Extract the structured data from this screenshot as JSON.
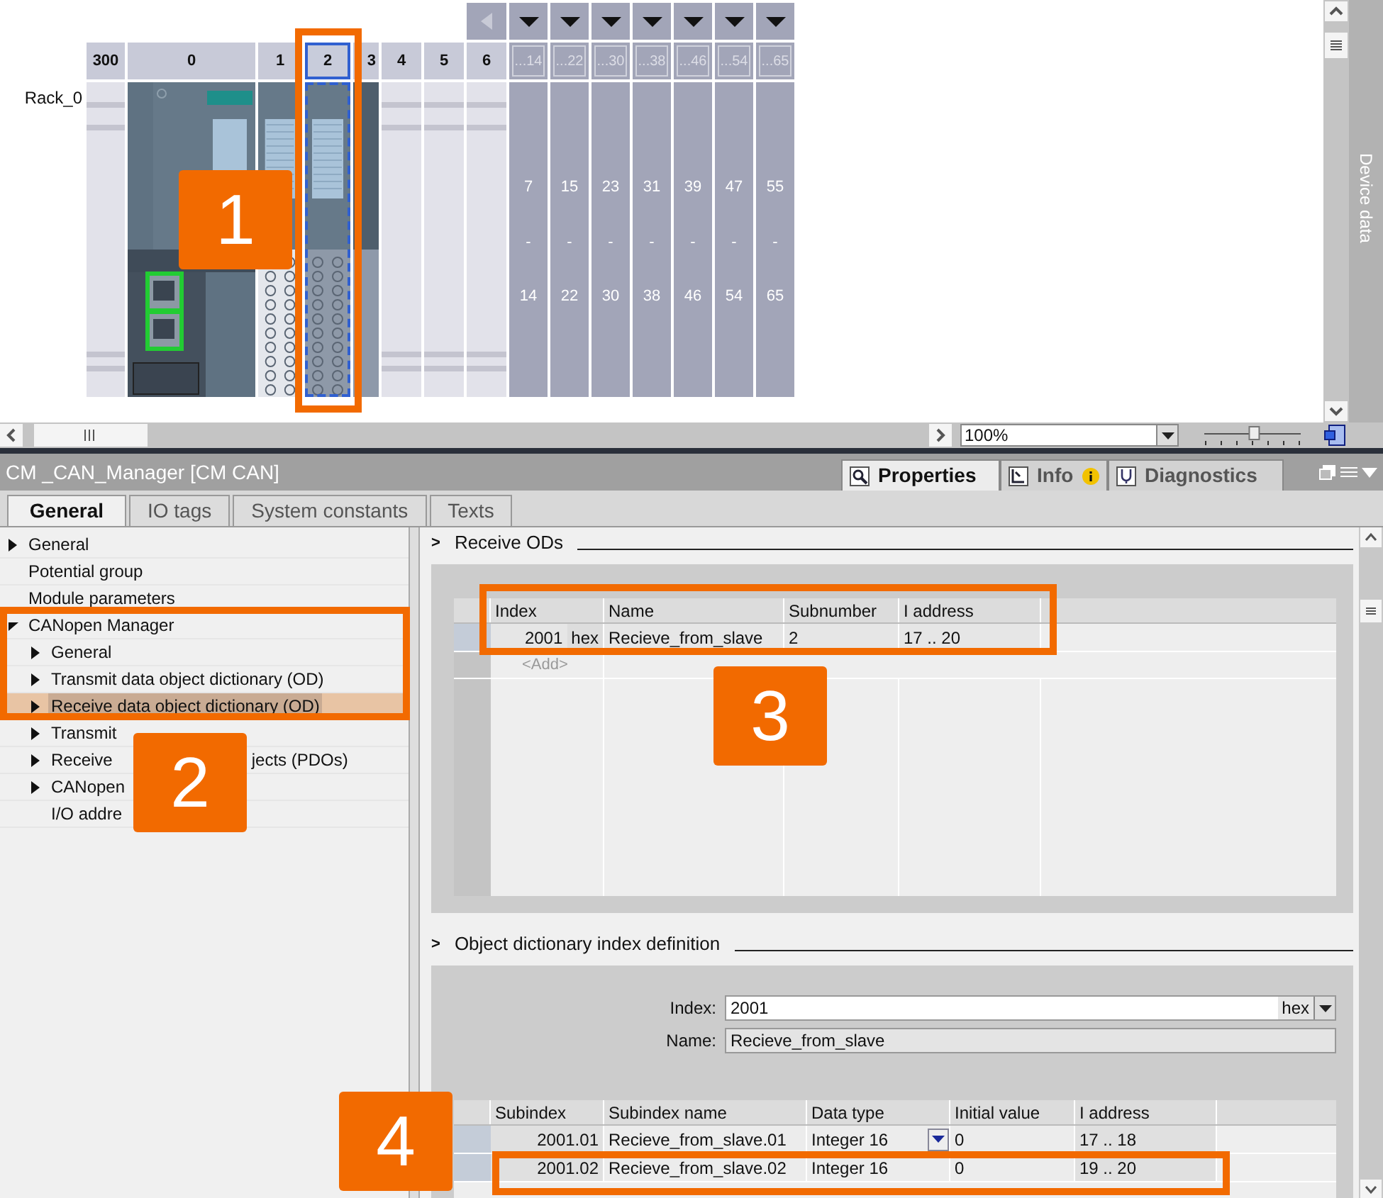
{
  "editor": {
    "rack": {
      "name": "Rack_0",
      "slots": [
        {
          "label": "300",
          "kind": "empty",
          "selected": false
        },
        {
          "label": "0",
          "kind": "cpu",
          "selected": false
        },
        {
          "label": "1",
          "kind": "module",
          "selected": false
        },
        {
          "label": "2",
          "kind": "module",
          "selected": true
        },
        {
          "label": "3",
          "kind": "filler",
          "selected": false
        },
        {
          "label": "4",
          "kind": "empty",
          "selected": false
        },
        {
          "label": "5",
          "kind": "empty",
          "selected": false
        },
        {
          "label": "6",
          "kind": "empty",
          "selected": false
        }
      ],
      "address_columns": [
        {
          "label": "...14",
          "start": "7",
          "dash": "-",
          "end": "14"
        },
        {
          "label": "...22",
          "start": "15",
          "dash": "-",
          "end": "22"
        },
        {
          "label": "...30",
          "start": "23",
          "dash": "-",
          "end": "30"
        },
        {
          "label": "...38",
          "start": "31",
          "dash": "-",
          "end": "38"
        },
        {
          "label": "...46",
          "start": "39",
          "dash": "-",
          "end": "46"
        },
        {
          "label": "...54",
          "start": "47",
          "dash": "-",
          "end": "54"
        },
        {
          "label": "...65",
          "start": "55",
          "dash": "-",
          "end": "65"
        }
      ]
    },
    "zoom": "100%",
    "zoom_slider": {
      "level": 0.52
    },
    "side_tab": "Device data"
  },
  "inspector": {
    "title": "CM _CAN_Manager [CM CAN]",
    "tabs": [
      {
        "label": "Properties",
        "kind": "properties",
        "selected": true
      },
      {
        "label": "Info",
        "kind": "info",
        "selected": false
      },
      {
        "label": "Diagnostics",
        "kind": "diagnostics",
        "selected": false
      }
    ],
    "subtabs": [
      {
        "label": "General",
        "selected": true
      },
      {
        "label": "IO tags",
        "selected": false
      },
      {
        "label": "System constants",
        "selected": false
      },
      {
        "label": "Texts",
        "selected": false
      }
    ],
    "tree": [
      {
        "label": "General",
        "expanded": false,
        "selected": false
      },
      {
        "label": "Potential group",
        "selected": false
      },
      {
        "label": "Module parameters",
        "selected": false
      },
      {
        "label": "CANopen Manager",
        "expanded": true,
        "selected": false,
        "children": [
          {
            "label": "General",
            "expanded": false,
            "selected": false
          },
          {
            "label": "Transmit data object dictionary (OD)",
            "expanded": false,
            "selected": false
          },
          {
            "label": "Receive data object dictionary (OD)",
            "expanded": false,
            "selected": true
          },
          {
            "label": "Transmit",
            "expanded": false,
            "selected": false
          },
          {
            "label": "Receive",
            "label_after": "jects (PDOs)",
            "expanded": false,
            "selected": false
          },
          {
            "label": "CANopen",
            "expanded": false,
            "selected": false
          },
          {
            "label": "I/O addre",
            "selected": false
          }
        ]
      }
    ],
    "receive_ods": {
      "toggle": ">",
      "title": "Receive ODs",
      "columns": [
        "Index",
        "Name",
        "Subnumber",
        "I address"
      ],
      "rows": [
        {
          "index": "2001",
          "unit": "hex",
          "name": "Recieve_from_slave",
          "subnumber": "2",
          "address": "17 .. 20"
        }
      ],
      "add_row": "<Add>"
    },
    "index_definition": {
      "toggle": ">",
      "title": "Object dictionary index definition",
      "index_label": "Index:",
      "index_value": "2001",
      "index_unit": "hex",
      "name_label": "Name:",
      "name_value": "Recieve_from_slave",
      "columns": [
        "Subindex",
        "Subindex name",
        "Data type",
        "Initial value",
        "I address"
      ],
      "rows": [
        {
          "subindex": "2001.01",
          "name": "Recieve_from_slave.01",
          "data_type": "Integer 16",
          "initial": "0",
          "address": "17 .. 18",
          "dropdown": true
        },
        {
          "subindex": "2001.02",
          "name": "Recieve_from_slave.02",
          "data_type": "Integer 16",
          "initial": "0",
          "address": "19 .. 20",
          "dropdown": false
        }
      ]
    }
  },
  "callouts": [
    "1",
    "2",
    "3",
    "4"
  ]
}
